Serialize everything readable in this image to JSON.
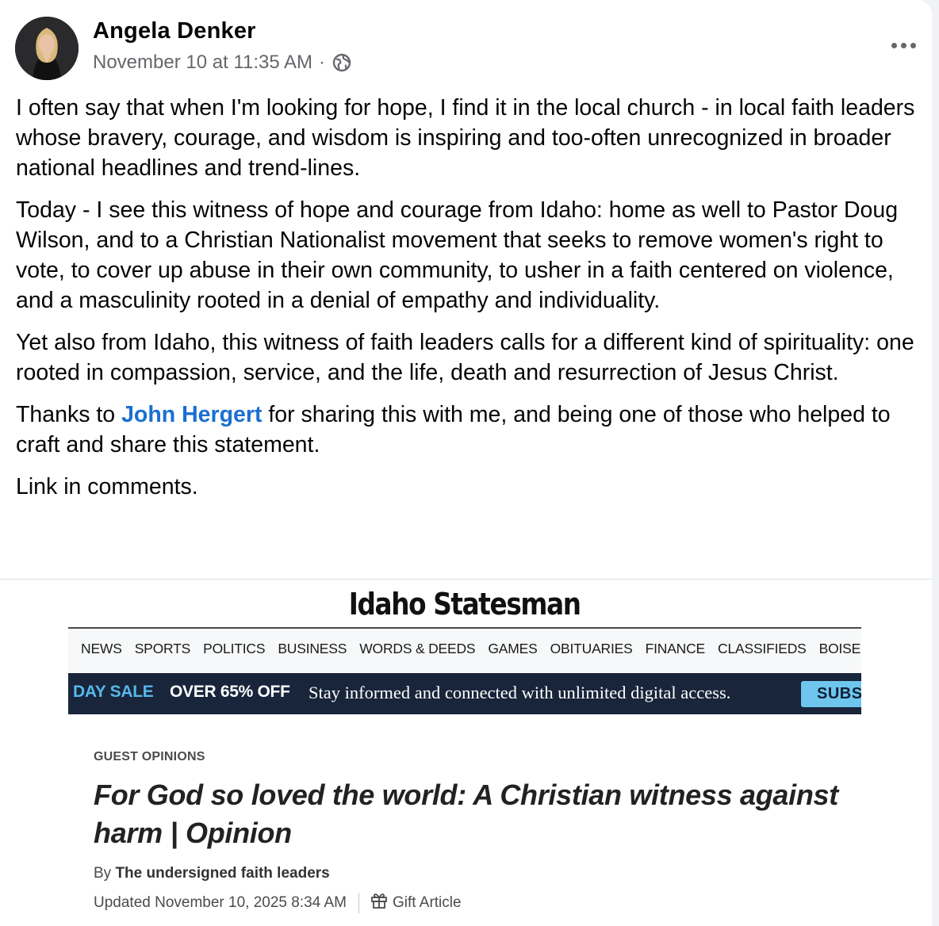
{
  "post": {
    "author": "Angela Denker",
    "timestamp": "November 10 at 11:35 AM",
    "separator": "·",
    "privacy_icon": "globe-icon",
    "more_icon": "more-options-icon",
    "paragraphs": [
      "I often say that when I'm looking for hope, I find it in the local church - in local faith leaders whose bravery, courage, and wisdom is inspiring and too-often unrecognized in broader national headlines and trend-lines.",
      "Today - I see this witness of hope and courage from Idaho: home as well to Pastor Doug Wilson, and to a Christian Nationalist movement that seeks to remove women's right to vote, to cover up abuse in their own community, to usher in a faith centered on violence, and a masculinity rooted in a denial of empathy and individuality.",
      "Yet also from Idaho, this witness of faith leaders calls for a different kind of spirituality: one rooted in compassion, service, and the life, death and resurrection of Jesus Christ."
    ],
    "thanks": {
      "before": "Thanks to ",
      "mention": "John Hergert",
      "after": " for sharing this with me, and being one of those who helped to craft and share this statement."
    },
    "closing": "Link in comments."
  },
  "preview": {
    "masthead": "Idaho Statesman",
    "nav": [
      "NEWS",
      "SPORTS",
      "POLITICS",
      "BUSINESS",
      "WORDS & DEEDS",
      "GAMES",
      "OBITUARIES",
      "FINANCE",
      "CLASSIFIEDS",
      "BOISE FAVORITE"
    ],
    "promo": {
      "sale": "DAY SALE",
      "offer": "OVER 65% OFF",
      "text": "Stay informed and connected with unlimited digital access.",
      "button": "SUBS"
    },
    "section": "GUEST OPINIONS",
    "headline": "For God so loved the world: A Christian witness against harm | Opinion",
    "byline_prefix": "By ",
    "byline_author": "The undersigned faith leaders",
    "updated": "Updated November 10, 2025 8:34 AM",
    "gift_label": "Gift Article",
    "gift_icon": "gift-icon"
  },
  "colors": {
    "mention": "#1a6fd1",
    "meta_text": "#65676b",
    "promo_bg": "#18253a",
    "promo_sale": "#58b7ea",
    "subscribe_button": "#6ec6ee"
  }
}
